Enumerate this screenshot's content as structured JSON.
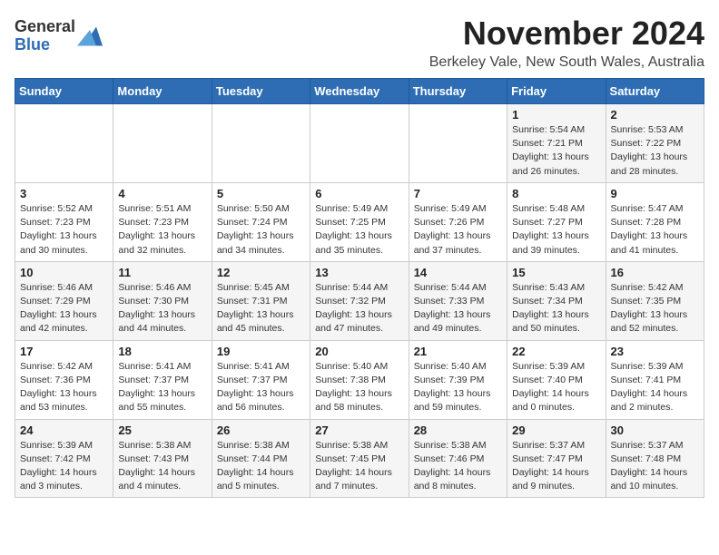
{
  "header": {
    "logo_line1": "General",
    "logo_line2": "Blue",
    "month": "November 2024",
    "location": "Berkeley Vale, New South Wales, Australia"
  },
  "days_of_week": [
    "Sunday",
    "Monday",
    "Tuesday",
    "Wednesday",
    "Thursday",
    "Friday",
    "Saturday"
  ],
  "weeks": [
    [
      {
        "day": "",
        "info": ""
      },
      {
        "day": "",
        "info": ""
      },
      {
        "day": "",
        "info": ""
      },
      {
        "day": "",
        "info": ""
      },
      {
        "day": "",
        "info": ""
      },
      {
        "day": "1",
        "info": "Sunrise: 5:54 AM\nSunset: 7:21 PM\nDaylight: 13 hours\nand 26 minutes."
      },
      {
        "day": "2",
        "info": "Sunrise: 5:53 AM\nSunset: 7:22 PM\nDaylight: 13 hours\nand 28 minutes."
      }
    ],
    [
      {
        "day": "3",
        "info": "Sunrise: 5:52 AM\nSunset: 7:23 PM\nDaylight: 13 hours\nand 30 minutes."
      },
      {
        "day": "4",
        "info": "Sunrise: 5:51 AM\nSunset: 7:23 PM\nDaylight: 13 hours\nand 32 minutes."
      },
      {
        "day": "5",
        "info": "Sunrise: 5:50 AM\nSunset: 7:24 PM\nDaylight: 13 hours\nand 34 minutes."
      },
      {
        "day": "6",
        "info": "Sunrise: 5:49 AM\nSunset: 7:25 PM\nDaylight: 13 hours\nand 35 minutes."
      },
      {
        "day": "7",
        "info": "Sunrise: 5:49 AM\nSunset: 7:26 PM\nDaylight: 13 hours\nand 37 minutes."
      },
      {
        "day": "8",
        "info": "Sunrise: 5:48 AM\nSunset: 7:27 PM\nDaylight: 13 hours\nand 39 minutes."
      },
      {
        "day": "9",
        "info": "Sunrise: 5:47 AM\nSunset: 7:28 PM\nDaylight: 13 hours\nand 41 minutes."
      }
    ],
    [
      {
        "day": "10",
        "info": "Sunrise: 5:46 AM\nSunset: 7:29 PM\nDaylight: 13 hours\nand 42 minutes."
      },
      {
        "day": "11",
        "info": "Sunrise: 5:46 AM\nSunset: 7:30 PM\nDaylight: 13 hours\nand 44 minutes."
      },
      {
        "day": "12",
        "info": "Sunrise: 5:45 AM\nSunset: 7:31 PM\nDaylight: 13 hours\nand 45 minutes."
      },
      {
        "day": "13",
        "info": "Sunrise: 5:44 AM\nSunset: 7:32 PM\nDaylight: 13 hours\nand 47 minutes."
      },
      {
        "day": "14",
        "info": "Sunrise: 5:44 AM\nSunset: 7:33 PM\nDaylight: 13 hours\nand 49 minutes."
      },
      {
        "day": "15",
        "info": "Sunrise: 5:43 AM\nSunset: 7:34 PM\nDaylight: 13 hours\nand 50 minutes."
      },
      {
        "day": "16",
        "info": "Sunrise: 5:42 AM\nSunset: 7:35 PM\nDaylight: 13 hours\nand 52 minutes."
      }
    ],
    [
      {
        "day": "17",
        "info": "Sunrise: 5:42 AM\nSunset: 7:36 PM\nDaylight: 13 hours\nand 53 minutes."
      },
      {
        "day": "18",
        "info": "Sunrise: 5:41 AM\nSunset: 7:37 PM\nDaylight: 13 hours\nand 55 minutes."
      },
      {
        "day": "19",
        "info": "Sunrise: 5:41 AM\nSunset: 7:37 PM\nDaylight: 13 hours\nand 56 minutes."
      },
      {
        "day": "20",
        "info": "Sunrise: 5:40 AM\nSunset: 7:38 PM\nDaylight: 13 hours\nand 58 minutes."
      },
      {
        "day": "21",
        "info": "Sunrise: 5:40 AM\nSunset: 7:39 PM\nDaylight: 13 hours\nand 59 minutes."
      },
      {
        "day": "22",
        "info": "Sunrise: 5:39 AM\nSunset: 7:40 PM\nDaylight: 14 hours\nand 0 minutes."
      },
      {
        "day": "23",
        "info": "Sunrise: 5:39 AM\nSunset: 7:41 PM\nDaylight: 14 hours\nand 2 minutes."
      }
    ],
    [
      {
        "day": "24",
        "info": "Sunrise: 5:39 AM\nSunset: 7:42 PM\nDaylight: 14 hours\nand 3 minutes."
      },
      {
        "day": "25",
        "info": "Sunrise: 5:38 AM\nSunset: 7:43 PM\nDaylight: 14 hours\nand 4 minutes."
      },
      {
        "day": "26",
        "info": "Sunrise: 5:38 AM\nSunset: 7:44 PM\nDaylight: 14 hours\nand 5 minutes."
      },
      {
        "day": "27",
        "info": "Sunrise: 5:38 AM\nSunset: 7:45 PM\nDaylight: 14 hours\nand 7 minutes."
      },
      {
        "day": "28",
        "info": "Sunrise: 5:38 AM\nSunset: 7:46 PM\nDaylight: 14 hours\nand 8 minutes."
      },
      {
        "day": "29",
        "info": "Sunrise: 5:37 AM\nSunset: 7:47 PM\nDaylight: 14 hours\nand 9 minutes."
      },
      {
        "day": "30",
        "info": "Sunrise: 5:37 AM\nSunset: 7:48 PM\nDaylight: 14 hours\nand 10 minutes."
      }
    ]
  ]
}
